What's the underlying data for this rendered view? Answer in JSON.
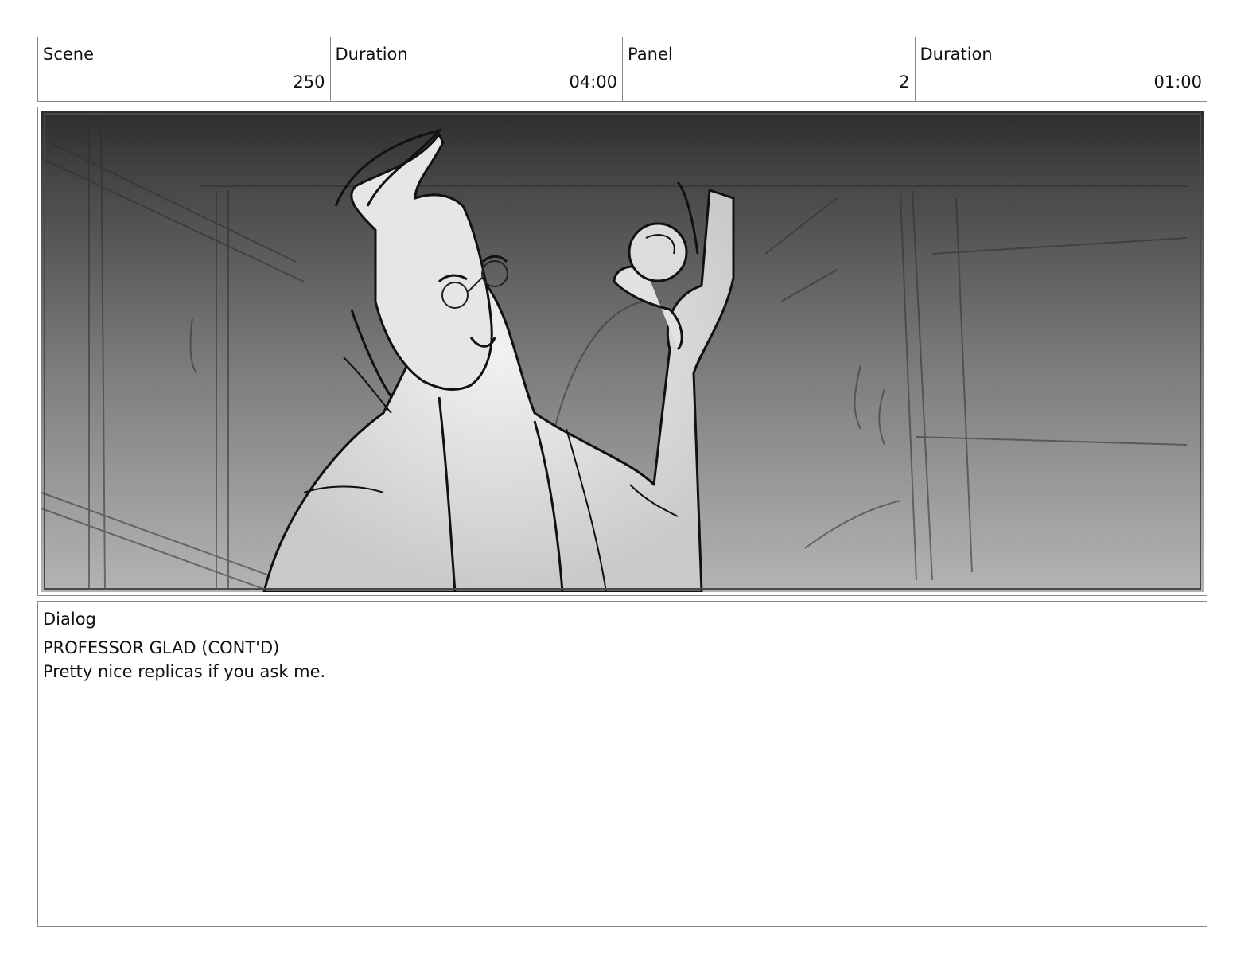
{
  "header": {
    "scene_label": "Scene",
    "scene_value": "250",
    "scene_duration_label": "Duration",
    "scene_duration_value": "04:00",
    "panel_label": "Panel",
    "panel_value": "2",
    "panel_duration_label": "Duration",
    "panel_duration_value": "01:00"
  },
  "panel_image": {
    "description_icon": "storyboard-sketch-image"
  },
  "dialog": {
    "label": "Dialog",
    "character": "PROFESSOR GLAD (CONT'D)",
    "line": "Pretty nice replicas if you ask me."
  }
}
